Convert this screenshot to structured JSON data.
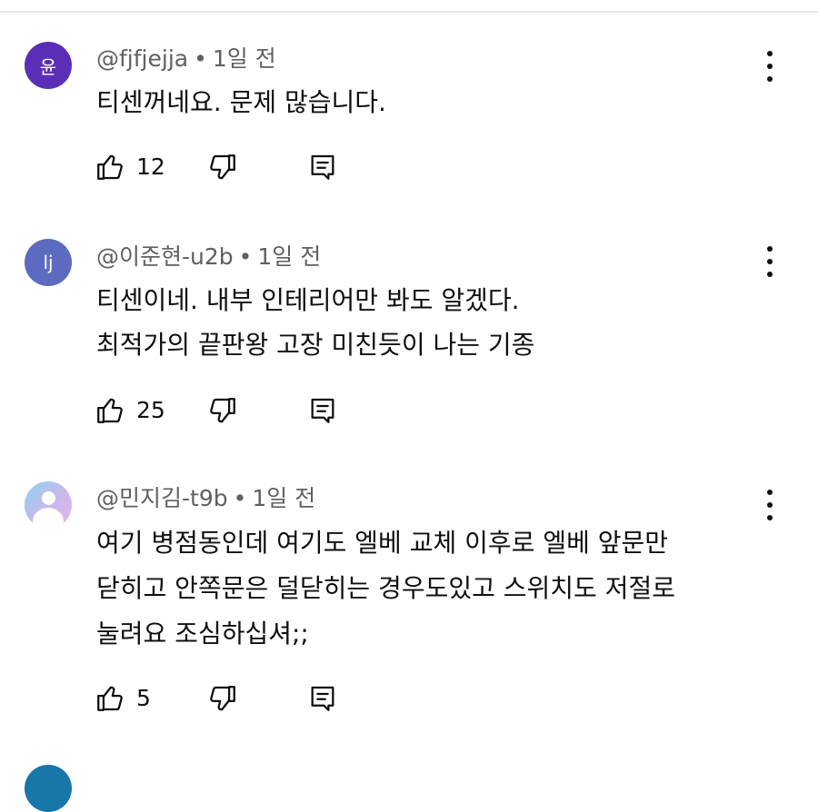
{
  "comments": [
    {
      "avatar_text": "윤",
      "avatar_color": "#5b2fb5",
      "username": "@fjfjejja",
      "time": "1일 전",
      "lines": [
        "티센꺼네요. 문제 많습니다."
      ],
      "likes": "12"
    },
    {
      "avatar_text": "lj",
      "avatar_color": "#5c6bc0",
      "username": "@이준현-u2b",
      "time": "1일 전",
      "lines": [
        "티센이네. 내부 인테리어만 봐도 알겠다.",
        "최적가의 끝판왕 고장 미친듯이 나는 기종"
      ],
      "likes": "25"
    },
    {
      "avatar_text": "",
      "avatar_color": "#c9b8ec",
      "username": "@민지김-t9b",
      "time": "1일 전",
      "lines": [
        "여기 병점동인데 여기도 엘베 교체 이후로 엘베 앞문만",
        "닫히고 안쪽문은 덜닫히는 경우도있고 스위치도 저절로",
        "눌려요 조심하십셔;;"
      ],
      "likes": "5"
    }
  ],
  "separator": "•",
  "icons": {
    "like": "thumb-up-icon",
    "dislike": "thumb-down-icon",
    "reply": "reply-icon",
    "more": "more-vertical-icon"
  },
  "colors": {
    "meta_text": "#606060",
    "body_text": "#0f0f0f",
    "divider": "#e5e5e5"
  }
}
